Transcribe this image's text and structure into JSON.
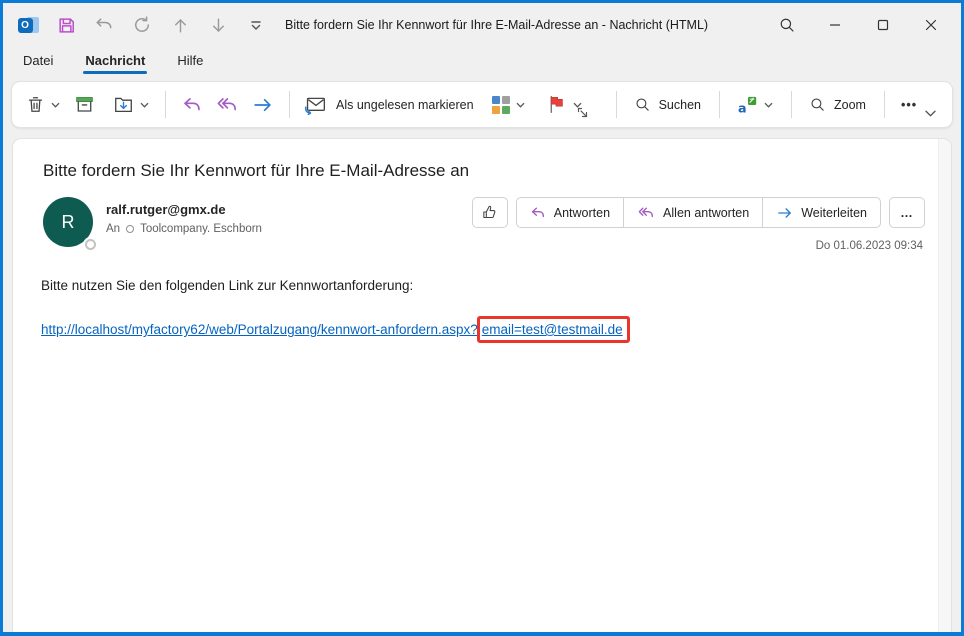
{
  "titlebar": {
    "title": "Bitte fordern Sie Ihr Kennwort für Ihre E-Mail-Adresse an  -  Nachricht (HTML)"
  },
  "menu": {
    "items": [
      {
        "label": "Datei",
        "active": false
      },
      {
        "label": "Nachricht",
        "active": true
      },
      {
        "label": "Hilfe",
        "active": false
      }
    ]
  },
  "ribbon": {
    "mark_unread_label": "Als ungelesen markieren",
    "search_label": "Suchen",
    "zoom_label": "Zoom",
    "more_label": "•••"
  },
  "message": {
    "subject": "Bitte fordern Sie Ihr Kennwort für Ihre E-Mail-Adresse an",
    "avatar_initial": "R",
    "sender_email": "ralf.rutger@gmx.de",
    "to_label": "An",
    "recipient": "Toolcompany. Eschborn",
    "date": "Do 01.06.2023 09:34",
    "reply_label": "Antworten",
    "reply_all_label": "Allen antworten",
    "forward_label": "Weiterleiten",
    "more_label": "…",
    "body_intro": "Bitte nutzen Sie den folgenden Link zur Kennwortanforderung:",
    "link_prefix": "http://localhost/myfactory62/web/Portalzugang/kennwort-anfordern.aspx?",
    "link_highlighted": "email=test@testmail.de"
  },
  "colors": {
    "window_border": "#0b7bd7",
    "accent": "#0f6cbd",
    "link": "#0563c1",
    "highlight_box": "#e9352d",
    "avatar_bg": "#0e5c51",
    "reply_purple": "#a35bc6",
    "forward_blue": "#2b7cd3",
    "flag_red": "#e8413c",
    "category_blue": "#4a86c8",
    "category_gray": "#a0a0a0",
    "category_orange": "#f0a23c",
    "category_green": "#5fa85f"
  }
}
